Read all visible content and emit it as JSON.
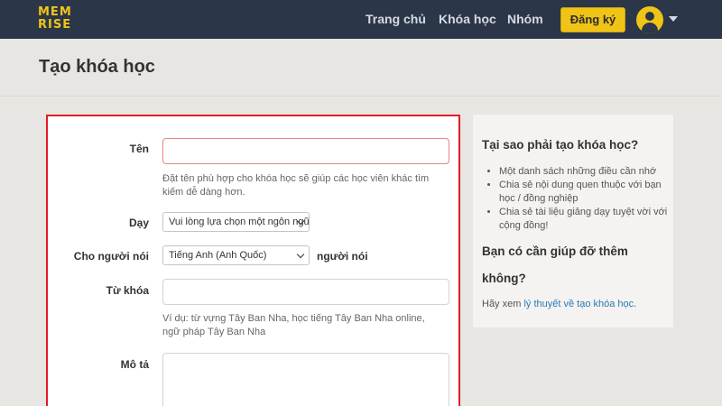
{
  "brand": {
    "logo_line1": "MEM",
    "logo_line2": "RISE"
  },
  "nav": {
    "home": "Trang chủ",
    "courses": "Khóa học",
    "groups": "Nhóm",
    "signup": "Đăng ký"
  },
  "page": {
    "title": "Tạo khóa học"
  },
  "form": {
    "name": {
      "label": "Tên",
      "value": "",
      "help": "Đặt tên phù hợp cho khóa học sẽ giúp các học viên khác tìm kiếm dễ dàng hơn."
    },
    "teach": {
      "label": "Dạy",
      "selected": "Vui lòng lựa chọn một ngôn ngữ"
    },
    "for_speakers": {
      "label": "Cho người nói",
      "selected": "Tiếng Anh (Anh Quốc)",
      "suffix": "người nói"
    },
    "keywords": {
      "label": "Từ khóa",
      "value": "",
      "help": "Ví dụ: từ vựng Tây Ban Nha, học tiếng Tây Ban Nha online, ngữ pháp Tây Ban Nha"
    },
    "description": {
      "label": "Mô tả",
      "value": ""
    }
  },
  "sidebar": {
    "title": "Tại sao phải tạo khóa học?",
    "reasons": [
      "Một danh sách những điều cần nhớ",
      "Chia sẻ nội dung quen thuộc với bạn học / đồng nghiệp",
      "Chia sẻ tài liệu giảng dạy tuyệt vời với cộng đồng!"
    ],
    "help_title_line1": "Bạn có cần giúp đỡ thêm",
    "help_title_line2": "không?",
    "see_prefix": "Hãy xem ",
    "see_link": "lý thuyết về tạo khóa học",
    "see_suffix": "."
  },
  "colors": {
    "nav_bg": "#2b3648",
    "brand_yellow": "#f0c416",
    "highlight_red": "#e31b23",
    "link_blue": "#2a7ab8"
  }
}
